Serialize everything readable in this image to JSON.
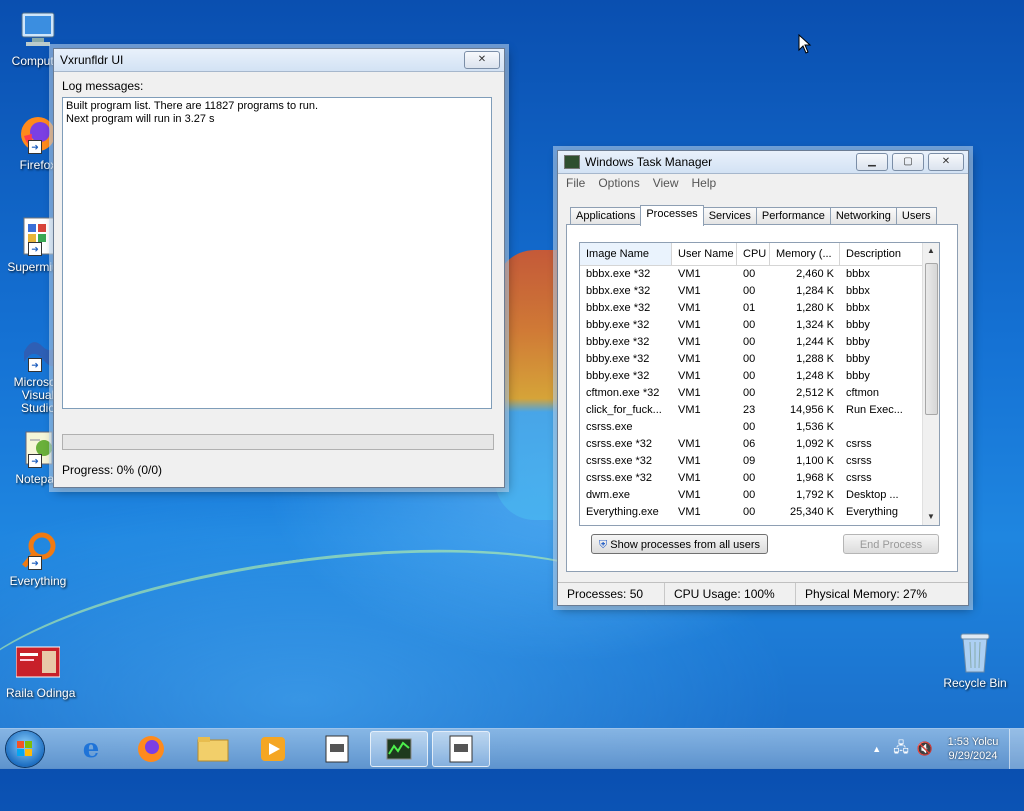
{
  "desktop": {
    "icons": [
      {
        "label": "Computer"
      },
      {
        "label": "Firefox"
      },
      {
        "label": "Supermium"
      },
      {
        "label": "Microsoft Visual Studio"
      },
      {
        "label": "Notepad"
      },
      {
        "label": "Everything"
      },
      {
        "label": "Raila Odinga"
      },
      {
        "label": "Recycle Bin"
      }
    ]
  },
  "vx_window": {
    "title": "Vxrunfldr UI",
    "log_label": "Log messages:",
    "log_lines": [
      "Built program list. There are 11827 programs to run.",
      "Next program will run in 3.27 s"
    ],
    "progress_text": "Progress: 0% (0/0)",
    "progress_fraction": 0
  },
  "task_manager": {
    "title": "Windows Task Manager",
    "menu": [
      "File",
      "Options",
      "View",
      "Help"
    ],
    "tabs": [
      "Applications",
      "Processes",
      "Services",
      "Performance",
      "Networking",
      "Users"
    ],
    "active_tab": "Processes",
    "columns": [
      "Image Name",
      "User Name",
      "CPU",
      "Memory (...",
      "Description"
    ],
    "rows": [
      [
        "bbbx.exe *32",
        "VM1",
        "00",
        "2,460 K",
        "bbbx"
      ],
      [
        "bbbx.exe *32",
        "VM1",
        "00",
        "1,284 K",
        "bbbx"
      ],
      [
        "bbbx.exe *32",
        "VM1",
        "01",
        "1,280 K",
        "bbbx"
      ],
      [
        "bbby.exe *32",
        "VM1",
        "00",
        "1,324 K",
        "bbby"
      ],
      [
        "bbby.exe *32",
        "VM1",
        "00",
        "1,244 K",
        "bbby"
      ],
      [
        "bbby.exe *32",
        "VM1",
        "00",
        "1,288 K",
        "bbby"
      ],
      [
        "bbby.exe *32",
        "VM1",
        "00",
        "1,248 K",
        "bbby"
      ],
      [
        "cftmon.exe *32",
        "VM1",
        "00",
        "2,512 K",
        "cftmon"
      ],
      [
        "click_for_fuck...",
        "VM1",
        "23",
        "14,956 K",
        "Run Exec..."
      ],
      [
        "csrss.exe",
        "",
        "00",
        "1,536 K",
        ""
      ],
      [
        "csrss.exe *32",
        "VM1",
        "06",
        "1,092 K",
        "csrss"
      ],
      [
        "csrss.exe *32",
        "VM1",
        "09",
        "1,100 K",
        "csrss"
      ],
      [
        "csrss.exe *32",
        "VM1",
        "00",
        "1,968 K",
        "csrss"
      ],
      [
        "dwm.exe",
        "VM1",
        "00",
        "1,792 K",
        "Desktop ..."
      ],
      [
        "Everything.exe",
        "VM1",
        "00",
        "25,340 K",
        "Everything"
      ]
    ],
    "show_all_button": "Show processes from all users",
    "end_process_button": "End Process",
    "status": {
      "processes": "Processes: 50",
      "cpu": "CPU Usage: 100%",
      "memory": "Physical Memory: 27%"
    }
  },
  "taskbar": {
    "time": "1:53 Yolcu",
    "date": "9/29/2024"
  }
}
